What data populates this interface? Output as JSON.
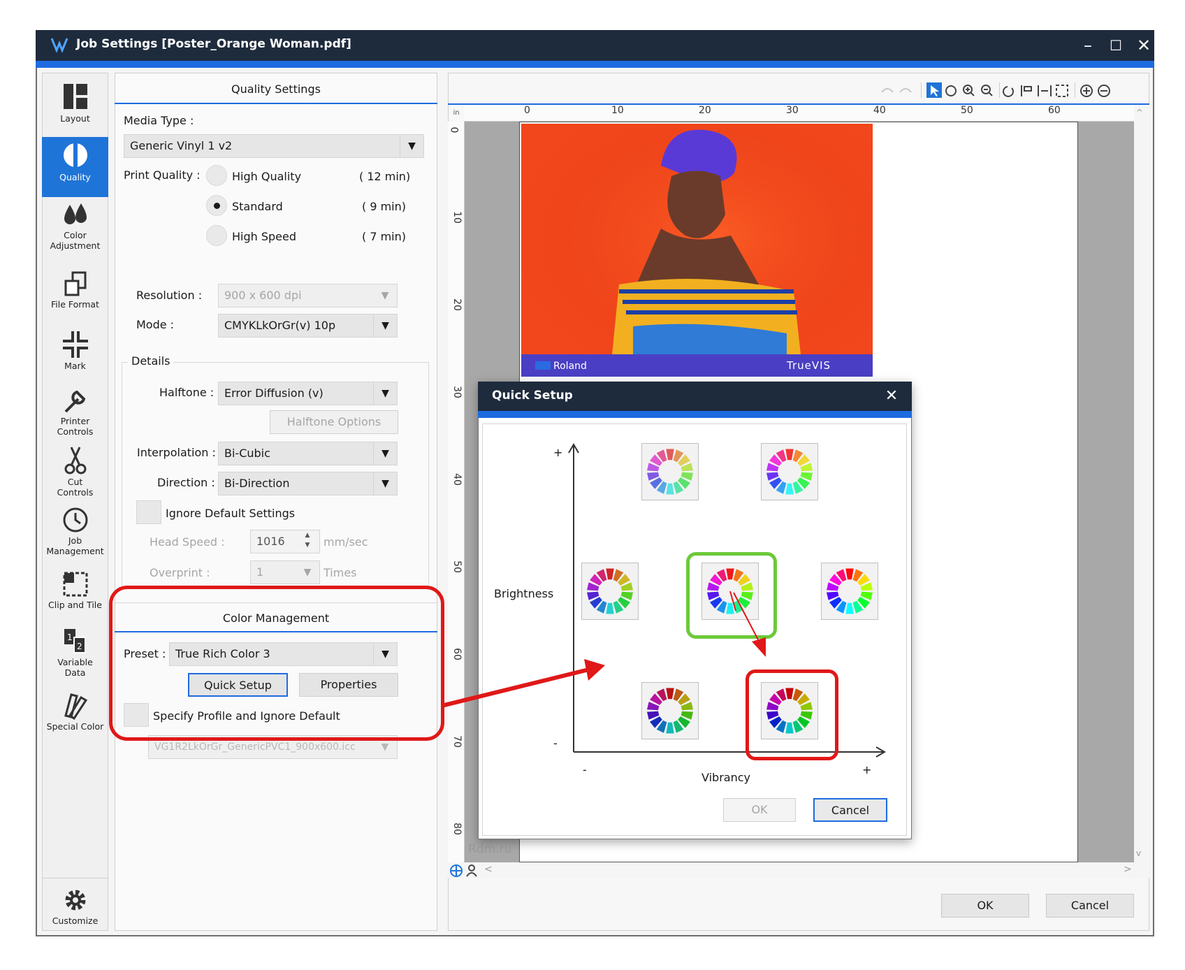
{
  "window": {
    "title": "Job Settings [Poster_Orange Woman.pdf]",
    "minimize": "–",
    "maximize": "☐",
    "close": "✕"
  },
  "sidebar": {
    "items": [
      {
        "label": "Layout"
      },
      {
        "label": "Quality"
      },
      {
        "label_1": "Color",
        "label_2": "Adjustment"
      },
      {
        "label": "File Format"
      },
      {
        "label": "Mark"
      },
      {
        "label_1": "Printer",
        "label_2": "Controls"
      },
      {
        "label_1": "Cut",
        "label_2": "Controls"
      },
      {
        "label_1": "Job",
        "label_2": "Management"
      },
      {
        "label": "Clip and Tile"
      },
      {
        "label_1": "Variable",
        "label_2": "Data"
      },
      {
        "label": "Special Color"
      },
      {
        "label": "Customize"
      }
    ]
  },
  "quality": {
    "header": "Quality Settings",
    "media_type_label": "Media Type :",
    "media_type_value": "Generic Vinyl 1 v2",
    "print_quality_label": "Print Quality :",
    "options": [
      {
        "label": "High Quality",
        "time": "( 12 min)",
        "selected": false
      },
      {
        "label": "Standard",
        "time": "( 9 min)",
        "selected": true
      },
      {
        "label": "High Speed",
        "time": "( 7 min)",
        "selected": false
      }
    ],
    "resolution_label": "Resolution :",
    "resolution_value": "900 x 600 dpi",
    "mode_label": "Mode :",
    "mode_value": "CMYKLkOrGr(v) 10p",
    "details_label": "Details",
    "halftone_label": "Halftone :",
    "halftone_value": "Error Diffusion (v)",
    "halftone_options_button": "Halftone Options",
    "interpolation_label": "Interpolation :",
    "interpolation_value": "Bi-Cubic",
    "direction_label": "Direction :",
    "direction_value": "Bi-Direction",
    "ignore_default_label": "Ignore Default Settings",
    "head_speed_label": "Head Speed :",
    "head_speed_value": "1016",
    "head_speed_unit": "mm/sec",
    "overprint_label": "Overprint :",
    "overprint_value": "1",
    "overprint_unit": "Times"
  },
  "color_management": {
    "header": "Color Management",
    "preset_label": "Preset :",
    "preset_value": "True Rich Color 3",
    "quick_setup_button": "Quick Setup",
    "properties_button": "Properties",
    "specify_profile_label": "Specify Profile and Ignore Default",
    "profile_value": "VG1R2LkOrGr_GenericPVC1_900x600.icc"
  },
  "preview": {
    "ruler_unit": "in",
    "h_ticks": [
      "0",
      "10",
      "20",
      "30",
      "40",
      "50",
      "60"
    ],
    "v_ticks": [
      "0",
      "10",
      "20",
      "30",
      "40",
      "50",
      "60",
      "70",
      "80"
    ],
    "image_brand_left": "Roland",
    "image_brand_right": "TrueVIS",
    "watermark": "Rdm.ru",
    "scroll_left": "<",
    "scroll_right": ">",
    "scroll_up": "^",
    "scroll_down": "v"
  },
  "quick_setup": {
    "title": "Quick Setup",
    "close": "✕",
    "y_axis_label": "Brightness",
    "x_axis_label": "Vibrancy",
    "y_plus": "+",
    "y_minus": "-",
    "x_minus": "-",
    "x_plus": "+",
    "ok_button": "OK",
    "cancel_button": "Cancel"
  },
  "footer": {
    "ok_button": "OK",
    "cancel_button": "Cancel"
  },
  "colors": {
    "title_bar": "#1e2b3c",
    "accent_blue": "#1e6be0",
    "highlight_red": "#e01818",
    "highlight_green": "#6dc93a",
    "poster_orange": "#f2461c"
  }
}
